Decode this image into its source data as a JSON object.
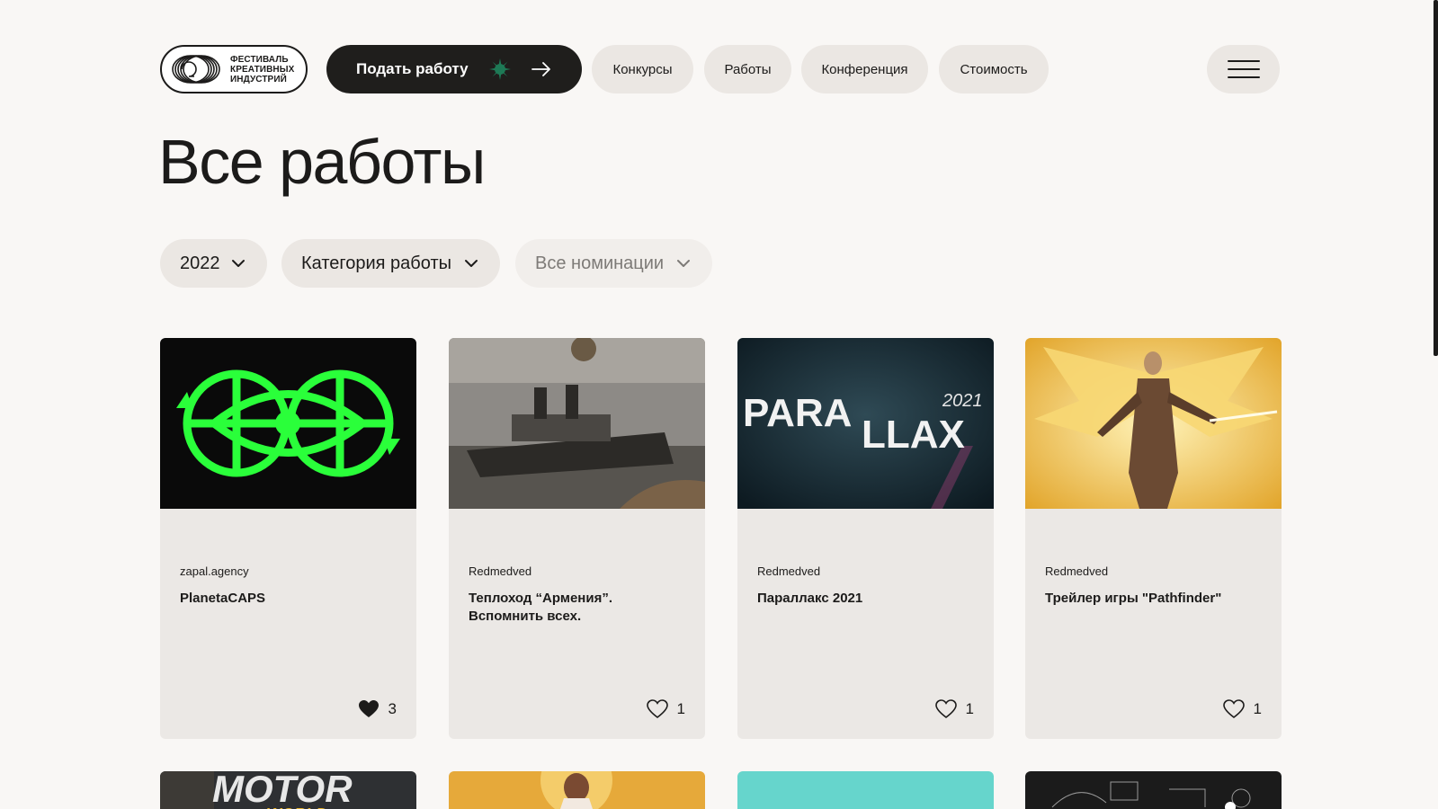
{
  "header": {
    "logo_lines": [
      "ФЕСТИВАЛЬ",
      "КРЕАТИВНЫХ",
      "ИНДУСТРИЙ"
    ],
    "submit_label": "Подать работу",
    "nav": [
      "Конкурсы",
      "Работы",
      "Конференция",
      "Стоимость"
    ]
  },
  "page_title": "Все работы",
  "filters": {
    "year": "2022",
    "category": "Категория работы",
    "nominations": "Все номинации"
  },
  "colors": {
    "background": "#f9f7f5",
    "accent_dark": "#1f1e1c",
    "accent_green": "#1e7a56",
    "pill": "#ebe7e3",
    "card": "#ebe8e5"
  },
  "works": [
    {
      "author": "zapal.agency",
      "title": "PlanetaCAPS",
      "likes": "3",
      "liked": true,
      "image_text": ""
    },
    {
      "author": "Redmedved",
      "title": "Теплоход “Армения”. Вспомнить всех.",
      "likes": "1",
      "liked": false,
      "image_text": ""
    },
    {
      "author": "Redmedved",
      "title": "Параллакс 2021",
      "likes": "1",
      "liked": false,
      "image_text": "PARALLAX 2021"
    },
    {
      "author": "Redmedved",
      "title": "Трейлер игры \"Pathfinder\"",
      "likes": "1",
      "liked": false,
      "image_text": ""
    }
  ],
  "row2_image_text": [
    "MOTOR WORLD"
  ]
}
